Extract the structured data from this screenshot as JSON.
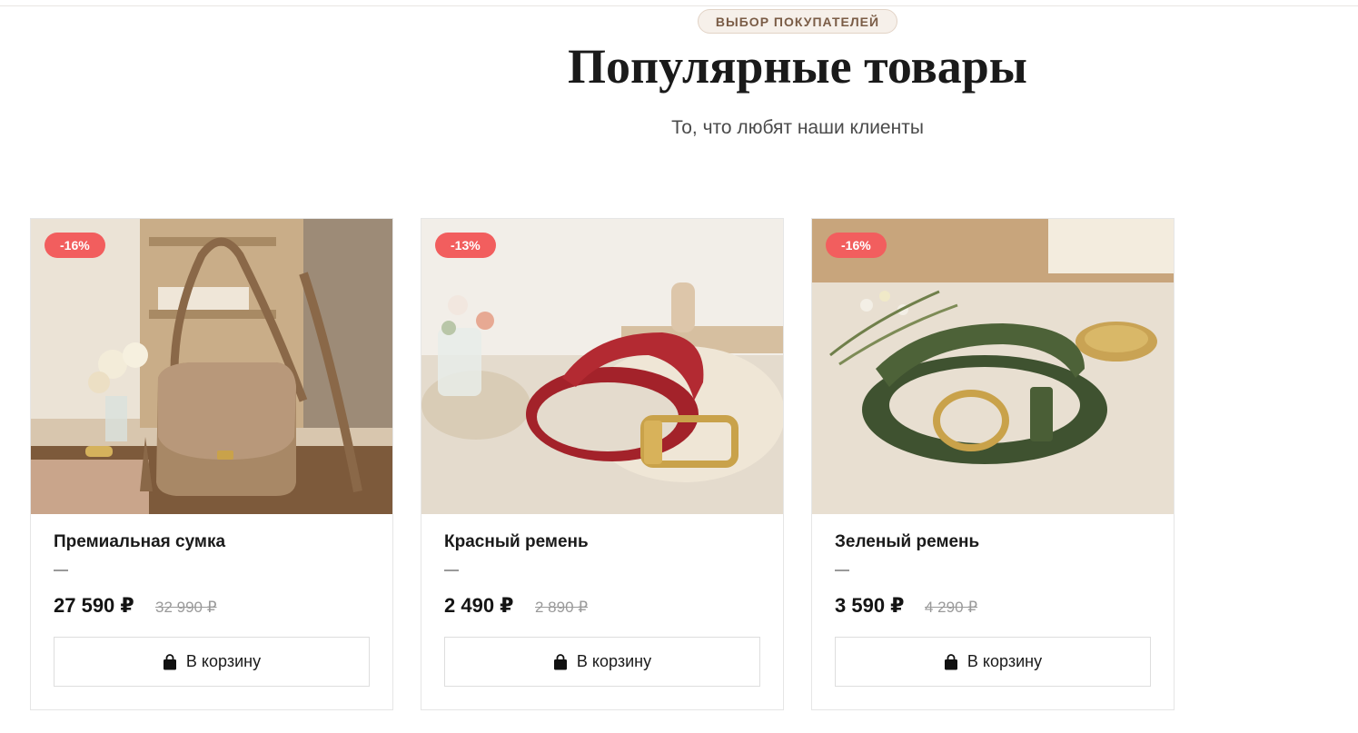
{
  "section": {
    "badge": "ВЫБОР ПОКУПАТЕЛЕЙ",
    "title": "Популярные товары",
    "subtitle": "То, что любят наши клиенты"
  },
  "colors": {
    "discount_badge": "#f25e5e",
    "badge_bg": "#f6f0ea",
    "badge_text": "#7a5c46"
  },
  "products": [
    {
      "name": "Премиальная сумка",
      "discount": "-16%",
      "price": "27 590 ₽",
      "old_price": "32 990 ₽",
      "cart_label": "В корзину",
      "cart_icon": "shopping-bag-icon"
    },
    {
      "name": "Красный ремень",
      "discount": "-13%",
      "price": "2 490 ₽",
      "old_price": "2 890 ₽",
      "cart_label": "В корзину",
      "cart_icon": "shopping-bag-icon"
    },
    {
      "name": "Зеленый ремень",
      "discount": "-16%",
      "price": "3 590 ₽",
      "old_price": "4 290 ₽",
      "cart_label": "В корзину",
      "cart_icon": "shopping-bag-icon"
    }
  ]
}
